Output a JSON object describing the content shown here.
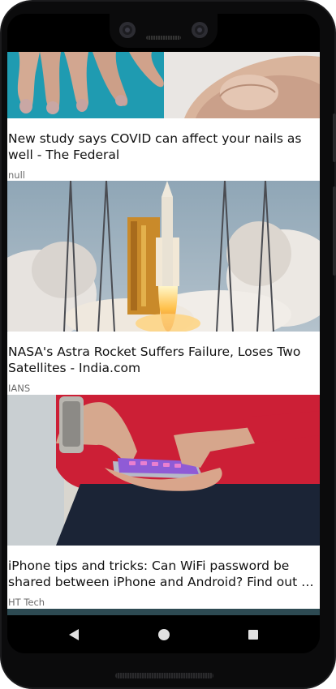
{
  "feed": {
    "articles": [
      {
        "title": "New study says COVID can affect your nails as well - The Federal",
        "source": "null",
        "image": "hands-and-fingernails-photo"
      },
      {
        "title": "NASA's Astra Rocket Suffers Failure, Loses Two Satellites - India.com",
        "source": "IANS",
        "image": "rocket-launch-photo"
      },
      {
        "title": "iPhone tips and tricks: Can WiFi password be shared between iPhone and Android? Find out - HT Tech",
        "source": "HT Tech",
        "image": "person-holding-iphone-photo"
      }
    ]
  },
  "navigation": {
    "back_icon": "triangle-back-icon",
    "home_icon": "circle-home-icon",
    "recents_icon": "square-recents-icon"
  },
  "colors": {
    "navbar_background": "#000000",
    "nav_icon": "#e0e0e0",
    "source_text": "#6b6b6b"
  }
}
